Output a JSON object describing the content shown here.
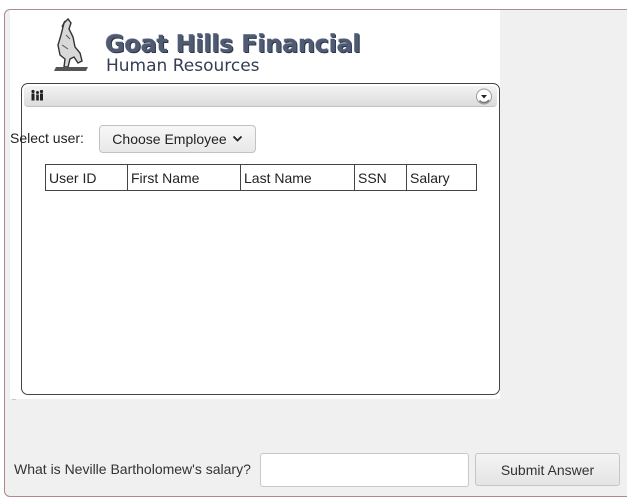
{
  "header": {
    "title": "Goat Hills Financial",
    "subtitle": "Human Resources",
    "logo_icon": "goat-icon"
  },
  "panel": {
    "left_icon": "people-icon",
    "right_icon": "collapse-toggle-icon"
  },
  "employee_select": {
    "label": "Select user:",
    "value": "Choose Employee",
    "icon": "chevron-down-icon"
  },
  "table": {
    "columns": [
      "User ID",
      "First Name",
      "Last Name",
      "SSN",
      "Salary"
    ],
    "rows": []
  },
  "quiz": {
    "question": "What is Neville Bartholomew's salary?",
    "answer_value": "",
    "answer_placeholder": "",
    "submit_label": "Submit Answer"
  },
  "colors": {
    "brand_text": "#4f5b73",
    "frame_border": "#b08a8a",
    "frame_background": "#f0f0f0"
  }
}
